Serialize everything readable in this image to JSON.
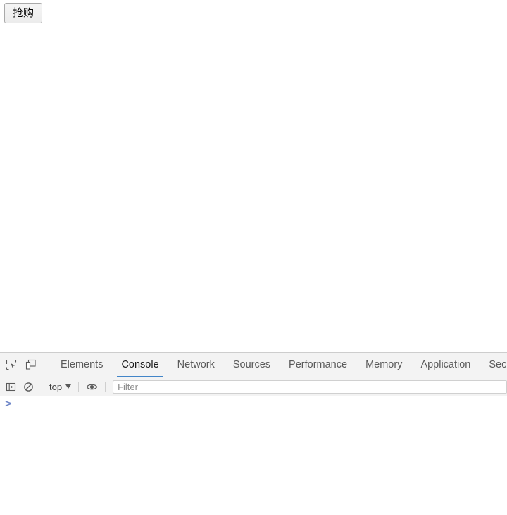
{
  "page": {
    "buy_button_label": "抢购"
  },
  "devtools": {
    "toolbar_icons": [
      {
        "name": "inspect-element-icon",
        "title": "Inspect element"
      },
      {
        "name": "device-toolbar-icon",
        "title": "Toggle device toolbar"
      }
    ],
    "tabs": [
      {
        "label": "Elements",
        "active": false
      },
      {
        "label": "Console",
        "active": true
      },
      {
        "label": "Network",
        "active": false
      },
      {
        "label": "Sources",
        "active": false
      },
      {
        "label": "Performance",
        "active": false
      },
      {
        "label": "Memory",
        "active": false
      },
      {
        "label": "Application",
        "active": false
      },
      {
        "label": "Security",
        "active": false
      }
    ],
    "active_tab": "Console",
    "accent_color": "#4285c8",
    "console_toolbar": {
      "sidebar_toggle_title": "Show console sidebar",
      "clear_console_title": "Clear console",
      "context_selector": "top",
      "eye_icon_title": "Create live expression",
      "filter_placeholder": "Filter",
      "filter_value": ""
    },
    "console": {
      "prompt_symbol": ">",
      "prompt_value": "",
      "messages": []
    }
  }
}
